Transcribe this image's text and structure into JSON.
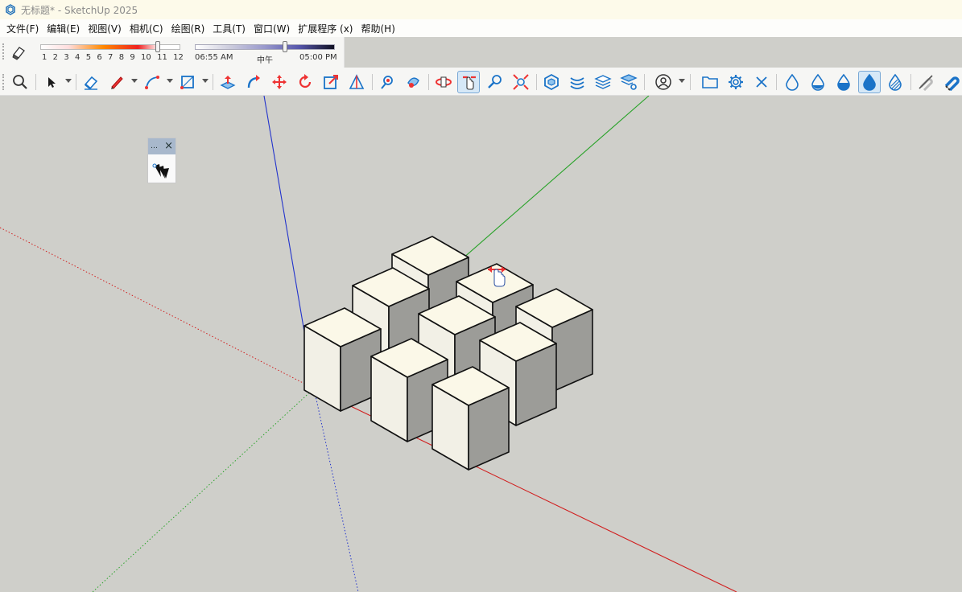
{
  "titlebar": {
    "title": "无标题* - SketchUp 2025",
    "icon": "sketchup-logo-icon"
  },
  "menu": [
    "文件(F)",
    "编辑(E)",
    "视图(V)",
    "相机(C)",
    "绘图(R)",
    "工具(T)",
    "窗口(W)",
    "扩展程序 (x)",
    "帮助(H)"
  ],
  "shadows": {
    "month_ticks": [
      "1",
      "2",
      "3",
      "4",
      "5",
      "6",
      "7",
      "8",
      "9",
      "10",
      "11",
      "12"
    ],
    "time_start": "06:55 AM",
    "time_mid": "中午",
    "time_end": "05:00 PM"
  },
  "toolbar": {
    "tools": [
      "zoom-search-icon",
      "select-arrow-icon",
      "eraser-icon",
      "pencil-line-icon",
      "arc-icon",
      "rectangle-icon",
      "push-pull-icon",
      "follow-me-icon",
      "move-icon",
      "rotate-icon",
      "scale-icon",
      "tape-icon",
      "position-camera-icon",
      "walk-icon",
      "orbit-icon",
      "pan-icon",
      "zoom-icon",
      "zoom-extents-icon",
      "component-icon",
      "sandbox-icon",
      "layers-icon",
      "styles-icon",
      "account-icon",
      "folder-icon",
      "settings-gear-icon",
      "close-x-icon",
      "drop-empty-icon",
      "drop-quarter-icon",
      "drop-half-icon",
      "drop-full-icon",
      "drop-hatched-icon",
      "magnet-off-icon",
      "magnet-on-icon"
    ],
    "active_tool": "pan-icon"
  },
  "colors": {
    "accent": "#1a73c8",
    "axis_red": "#d11f1f",
    "axis_green": "#2aa32a",
    "axis_blue": "#2233cc",
    "box_face": "#fbf8e8",
    "viewport_bg": "#cfcfca"
  }
}
